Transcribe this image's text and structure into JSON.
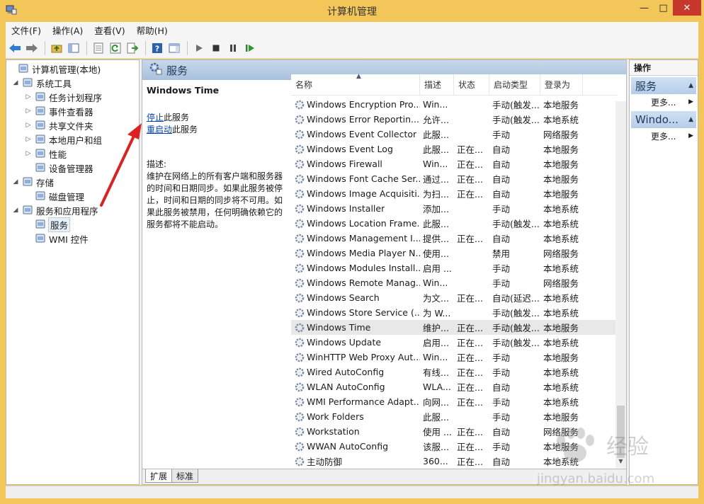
{
  "window": {
    "title": "计算机管理"
  },
  "menubar": {
    "items": [
      "文件(F)",
      "操作(A)",
      "查看(V)",
      "帮助(H)"
    ]
  },
  "tree": {
    "items": [
      {
        "label": "计算机管理(本地)",
        "exp": "",
        "icon": "computer-management-icon"
      },
      {
        "label": "系统工具",
        "exp": "◢",
        "icon": "system-tools-icon"
      },
      {
        "label": "任务计划程序",
        "exp": "▷",
        "icon": "task-scheduler-icon"
      },
      {
        "label": "事件查看器",
        "exp": "▷",
        "icon": "event-viewer-icon"
      },
      {
        "label": "共享文件夹",
        "exp": "▷",
        "icon": "shared-folders-icon"
      },
      {
        "label": "本地用户和组",
        "exp": "▷",
        "icon": "local-users-icon"
      },
      {
        "label": "性能",
        "exp": "▷",
        "icon": "performance-icon"
      },
      {
        "label": "设备管理器",
        "exp": "",
        "icon": "device-manager-icon"
      },
      {
        "label": "存储",
        "exp": "◢",
        "icon": "storage-icon"
      },
      {
        "label": "磁盘管理",
        "exp": "",
        "icon": "disk-management-icon"
      },
      {
        "label": "服务和应用程序",
        "exp": "◢",
        "icon": "services-apps-icon"
      },
      {
        "label": "服务",
        "exp": "",
        "icon": "services-icon"
      },
      {
        "label": "WMI 控件",
        "exp": "",
        "icon": "wmi-control-icon"
      }
    ]
  },
  "middle": {
    "header": "服务",
    "detail": {
      "service_name": "Windows Time",
      "stop_link": "停止",
      "stop_suffix": "此服务",
      "restart_link": "重启动",
      "restart_suffix": "此服务",
      "desc_label": "描述:",
      "description": "维护在网络上的所有客户端和服务器的时间和日期同步。如果此服务被停止，时间和日期的同步将不可用。如果此服务被禁用，任何明确依赖它的服务都将不能启动。"
    },
    "columns": [
      "名称",
      "描述",
      "状态",
      "启动类型",
      "登录为"
    ],
    "rows": [
      [
        "Windows Encryption Pro...",
        "Win...",
        "",
        "手动(触发...",
        "本地服务"
      ],
      [
        "Windows Error Reportin...",
        "允许...",
        "",
        "手动(触发...",
        "本地系统"
      ],
      [
        "Windows Event Collector",
        "此服...",
        "",
        "手动",
        "网络服务"
      ],
      [
        "Windows Event Log",
        "此服...",
        "正在...",
        "自动",
        "本地服务"
      ],
      [
        "Windows Firewall",
        "Win...",
        "正在...",
        "自动",
        "本地服务"
      ],
      [
        "Windows Font Cache Ser...",
        "通过...",
        "正在...",
        "自动",
        "本地服务"
      ],
      [
        "Windows Image Acquisiti...",
        "为扫...",
        "正在...",
        "自动",
        "本地服务"
      ],
      [
        "Windows Installer",
        "添加...",
        "",
        "手动",
        "本地系统"
      ],
      [
        "Windows Location Frame...",
        "此服...",
        "",
        "手动(触发...",
        "本地系统"
      ],
      [
        "Windows Management I...",
        "提供...",
        "正在...",
        "自动",
        "本地系统"
      ],
      [
        "Windows Media Player N...",
        "使用...",
        "",
        "禁用",
        "网络服务"
      ],
      [
        "Windows Modules Install...",
        "启用 ...",
        "",
        "手动",
        "本地系统"
      ],
      [
        "Windows Remote Manag...",
        "Win...",
        "",
        "手动",
        "网络服务"
      ],
      [
        "Windows Search",
        "为文...",
        "正在...",
        "自动(延迟...",
        "本地系统"
      ],
      [
        "Windows Store Service (...",
        "为 W...",
        "",
        "手动(触发...",
        "本地系统"
      ],
      [
        "Windows Time",
        "维护...",
        "正在...",
        "手动(触发...",
        "本地服务"
      ],
      [
        "Windows Update",
        "启用...",
        "正在...",
        "手动(触发...",
        "本地系统"
      ],
      [
        "WinHTTP Web Proxy Aut...",
        "Win...",
        "正在...",
        "手动",
        "本地服务"
      ],
      [
        "Wired AutoConfig",
        "有线...",
        "正在...",
        "手动",
        "本地系统"
      ],
      [
        "WLAN AutoConfig",
        "WLA...",
        "正在...",
        "自动",
        "本地系统"
      ],
      [
        "WMI Performance Adapt...",
        "向网...",
        "正在...",
        "手动",
        "本地系统"
      ],
      [
        "Work Folders",
        "此服...",
        "",
        "手动",
        "本地服务"
      ],
      [
        "Workstation",
        "使用 ...",
        "正在...",
        "自动",
        "网络服务"
      ],
      [
        "WWAN AutoConfig",
        "该服...",
        "正在...",
        "手动",
        "本地服务"
      ],
      [
        "主动防御",
        "360...",
        "正在...",
        "自动",
        "本地系统"
      ]
    ],
    "selected_row": 15,
    "tabs": [
      "扩展",
      "标准"
    ]
  },
  "actions_pane": {
    "title": "操作",
    "sections": [
      {
        "label": "服务",
        "more": "更多..."
      },
      {
        "label": "Windo...",
        "more": "更多..."
      }
    ]
  },
  "watermark": {
    "text": "经验",
    "url": "jingyan.baidu.com"
  },
  "colors": {
    "accent": "#1e395b",
    "close": "#c7372c",
    "frame": "#f3c65a",
    "arrow": "#e02020"
  }
}
